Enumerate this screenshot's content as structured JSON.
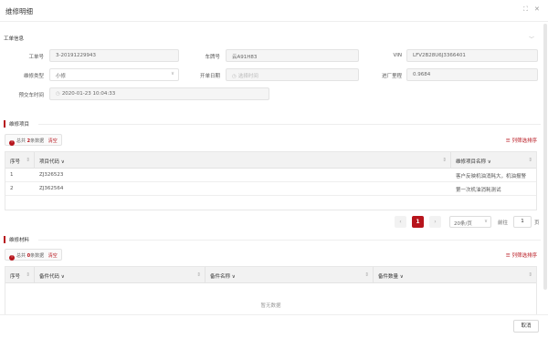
{
  "dialog": {
    "title": "维修明细",
    "maximize_glyph": "⛶",
    "close_glyph": "✕"
  },
  "basic_info": {
    "section_title": "工单信息",
    "collapse_glyph": "﹀",
    "fields": {
      "order_no": {
        "label": "工单号",
        "value": "3-20191229943"
      },
      "plate_no": {
        "label": "车牌号",
        "value": "云A91H83"
      },
      "vin": {
        "label": "VIN",
        "value": "LFV2B28U6J3366401"
      },
      "repair_type": {
        "label": "维修类型",
        "value": "小修"
      },
      "open_date": {
        "label": "开单日期",
        "placeholder": "选择时间"
      },
      "mileage": {
        "label": "进厂里程",
        "value": "0.9684"
      },
      "delivery_time": {
        "label": "预交车时间",
        "value": "2020-01-23 10:04:33"
      }
    }
  },
  "repair_items": {
    "section_title": "维修项目",
    "count_prefix": "总共",
    "count": "2",
    "count_suffix": "条数据",
    "clear_label": "清空",
    "filter_label": "列筛选排序",
    "columns": [
      "序号",
      "项目代码",
      "维修项目名称"
    ],
    "rows": [
      {
        "seq": "1",
        "code": "ZJ326523",
        "name": "客户反映机油消耗大，机油报警"
      },
      {
        "seq": "2",
        "code": "ZJ362564",
        "name": "第一次机油消耗测试"
      }
    ]
  },
  "pagination": {
    "prev_glyph": "‹",
    "current_page": "1",
    "next_glyph": "›",
    "page_size": "20条/页",
    "goto_label": "前往",
    "goto_value": "1",
    "page_unit": "页"
  },
  "repair_materials": {
    "section_title": "维修材料",
    "count_prefix": "总共",
    "count": "0",
    "count_suffix": "条数据",
    "clear_label": "清空",
    "filter_label": "列筛选排序",
    "columns": [
      "序号",
      "备件代码",
      "备件名称",
      "备件数量"
    ],
    "empty_text": "暂无数据"
  },
  "footer": {
    "cancel_label": "取消"
  },
  "icons": {
    "info": "!",
    "filter": "☰",
    "sort": "⇕",
    "dropdown": "∨",
    "clock": "◷"
  },
  "colors": {
    "accent": "#b7141c",
    "header_bg": "#f2f2f2",
    "readonly_bg": "#f5f5f5"
  }
}
